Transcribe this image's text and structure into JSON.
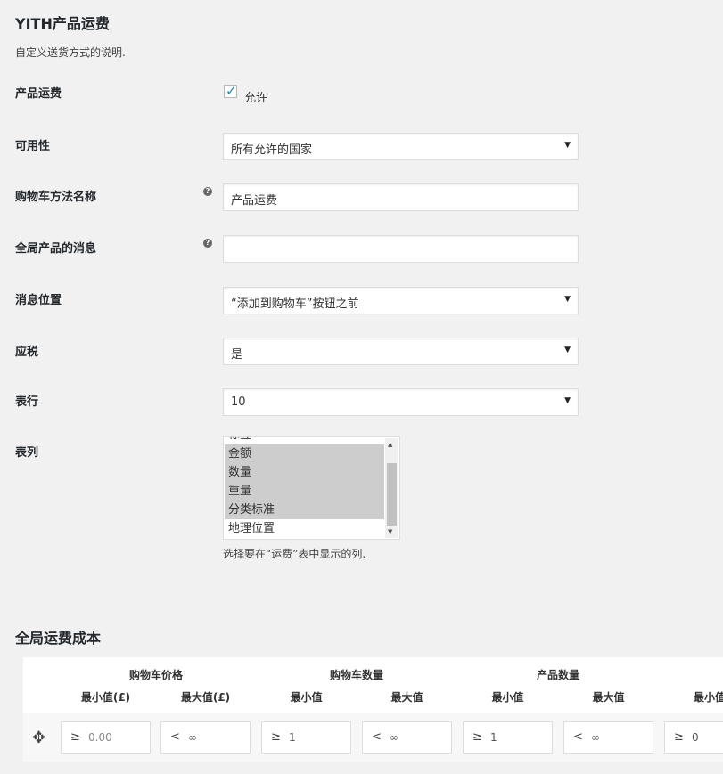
{
  "section": {
    "title": "YITH产品运费",
    "description": "自定义送货方式的说明."
  },
  "fields": {
    "enable": {
      "label": "产品运费",
      "checkbox_label": "允许",
      "checked": true
    },
    "availability": {
      "label": "可用性",
      "value": "所有允许的国家"
    },
    "cart_method_name": {
      "label": "购物车方法名称",
      "value": "产品运费"
    },
    "global_message": {
      "label": "全局产品的消息",
      "value": ""
    },
    "message_position": {
      "label": "消息位置",
      "value": "“添加到购物车”按钮之前"
    },
    "taxable": {
      "label": "应税",
      "value": "是"
    },
    "table_rows": {
      "label": "表行",
      "value": "10"
    },
    "table_columns": {
      "label": "表列",
      "partial_top_option": "标签",
      "options": [
        {
          "label": "金额",
          "selected": true
        },
        {
          "label": "数量",
          "selected": true
        },
        {
          "label": "重量",
          "selected": true
        },
        {
          "label": "分类标准",
          "selected": true
        },
        {
          "label": "地理位置",
          "selected": false
        }
      ],
      "hint": "选择要在“运费”表中显示的列."
    }
  },
  "global_costs": {
    "title": "全局运费成本",
    "groups": [
      "购物车价格",
      "购物车数量",
      "产品数量"
    ],
    "subheaders": [
      "最小值(£)",
      "最大值(£)",
      "最小值",
      "最大值",
      "最小值",
      "最大值",
      "最小值"
    ],
    "row": [
      {
        "symbol": "≥",
        "value": "0.00"
      },
      {
        "symbol": "<",
        "value": "∞"
      },
      {
        "symbol": "≥",
        "value": "1"
      },
      {
        "symbol": "<",
        "value": "∞"
      },
      {
        "symbol": "≥",
        "value": "1"
      },
      {
        "symbol": "<",
        "value": "∞"
      },
      {
        "symbol": "≥",
        "value": "0"
      }
    ]
  }
}
